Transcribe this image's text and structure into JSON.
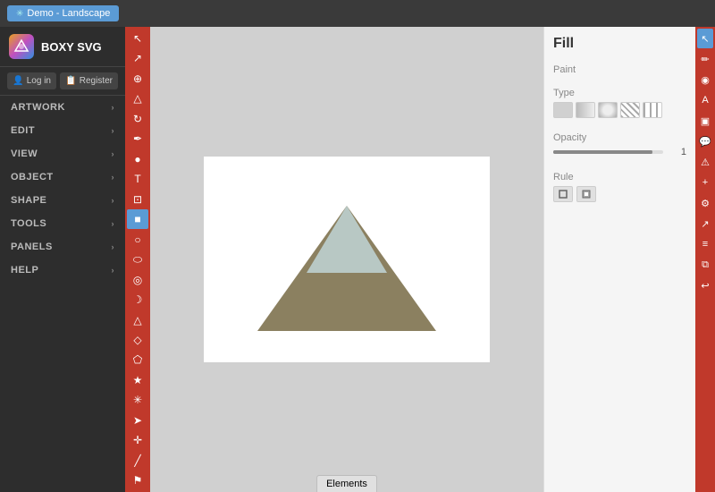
{
  "app": {
    "title": "BOXY SVG",
    "demo_tab_label": "Demo - Landscape",
    "demo_star": "✳"
  },
  "auth": {
    "login_label": "Log in",
    "register_label": "Register",
    "login_icon": "👤",
    "register_icon": "📋"
  },
  "menu": [
    {
      "id": "artwork",
      "label": "ARTWORK"
    },
    {
      "id": "edit",
      "label": "EDIT"
    },
    {
      "id": "view",
      "label": "VIEW"
    },
    {
      "id": "object",
      "label": "OBJECT"
    },
    {
      "id": "shape",
      "label": "SHAPE"
    },
    {
      "id": "tools",
      "label": "TOOLS"
    },
    {
      "id": "panels",
      "label": "PANELS"
    },
    {
      "id": "help",
      "label": "HELP"
    }
  ],
  "tools": [
    {
      "id": "cursor",
      "icon": "↖",
      "active": false
    },
    {
      "id": "select",
      "icon": "↗",
      "active": false
    },
    {
      "id": "pan",
      "icon": "⊕",
      "active": false
    },
    {
      "id": "zoom-in",
      "icon": "△",
      "active": false
    },
    {
      "id": "rotate",
      "icon": "↻",
      "active": false
    },
    {
      "id": "pen",
      "icon": "✒",
      "active": false
    },
    {
      "id": "pencil",
      "icon": "●",
      "active": false
    },
    {
      "id": "text",
      "icon": "T",
      "active": false
    },
    {
      "id": "crop",
      "icon": "⊡",
      "active": false
    },
    {
      "id": "rect",
      "icon": "■",
      "active": true
    },
    {
      "id": "circle",
      "icon": "○",
      "active": false
    },
    {
      "id": "ellipse",
      "icon": "⬭",
      "active": false
    },
    {
      "id": "target",
      "icon": "◎",
      "active": false
    },
    {
      "id": "crescent",
      "icon": "☽",
      "active": false
    },
    {
      "id": "triangle",
      "icon": "△",
      "active": false
    },
    {
      "id": "diamond",
      "icon": "◇",
      "active": false
    },
    {
      "id": "pentagon",
      "icon": "⬠",
      "active": false
    },
    {
      "id": "star",
      "icon": "★",
      "active": false
    },
    {
      "id": "asterisk",
      "icon": "✳",
      "active": false
    },
    {
      "id": "arrow",
      "icon": "➤",
      "active": false
    },
    {
      "id": "cross",
      "icon": "✛",
      "active": false
    },
    {
      "id": "line",
      "icon": "╱",
      "active": false
    },
    {
      "id": "flag",
      "icon": "⚑",
      "active": false
    }
  ],
  "right_tools": [
    {
      "id": "select-r",
      "icon": "↖",
      "active": true
    },
    {
      "id": "pen-r",
      "icon": "✏",
      "active": false
    },
    {
      "id": "node-r",
      "icon": "◉",
      "active": false
    },
    {
      "id": "text-r",
      "icon": "A",
      "active": false
    },
    {
      "id": "rect-r",
      "icon": "▣",
      "active": false
    },
    {
      "id": "comment-r",
      "icon": "💬",
      "active": false
    },
    {
      "id": "warning-r",
      "icon": "⚠",
      "active": false
    },
    {
      "id": "add-r",
      "icon": "+",
      "active": false
    },
    {
      "id": "gear-r",
      "icon": "⚙",
      "active": false
    },
    {
      "id": "export-r",
      "icon": "↗",
      "active": false
    },
    {
      "id": "grid-r",
      "icon": "≡",
      "active": false
    },
    {
      "id": "layers-r",
      "icon": "⧉",
      "active": false
    },
    {
      "id": "undo-r",
      "icon": "↩",
      "active": false
    }
  ],
  "fill_panel": {
    "title": "Fill",
    "paint_label": "Paint",
    "type_label": "Type",
    "opacity_label": "Opacity",
    "opacity_value": "1",
    "rule_label": "Rule",
    "types": [
      "solid",
      "linear",
      "radial",
      "stripe",
      "pattern"
    ]
  },
  "canvas": {
    "elements_tab": "Elements"
  }
}
